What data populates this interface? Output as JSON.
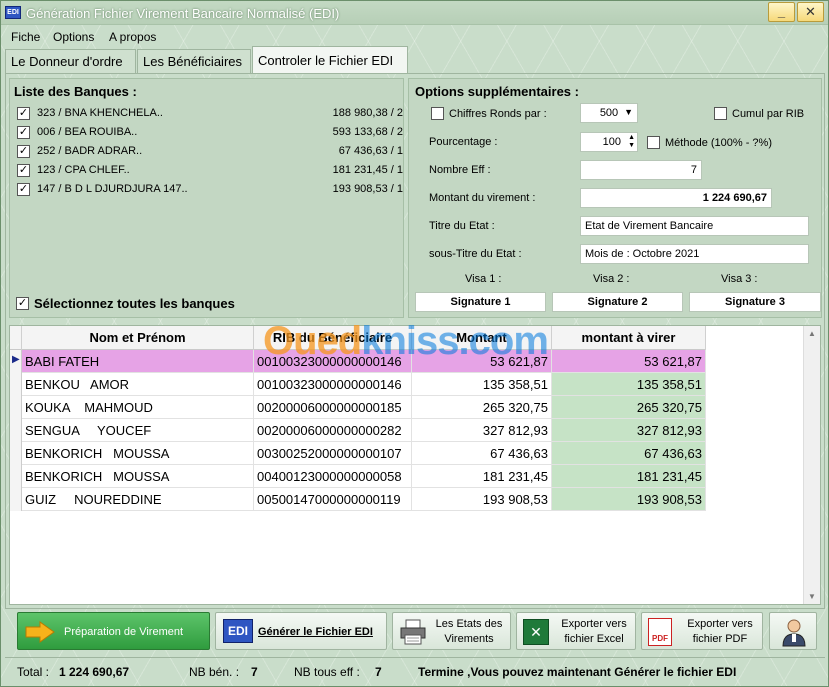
{
  "window": {
    "title": "Génération Fichier Virement Bancaire Normalisé (EDI)",
    "icon_text": "EDI",
    "minimize": "_",
    "close": "✕"
  },
  "menu": [
    "Fiche",
    "Options",
    "A propos"
  ],
  "tabs": [
    "Le Donneur d'ordre",
    "Les Bénéficiaires",
    "Controler le Fichier EDI"
  ],
  "banks": {
    "title": "Liste des Banques :",
    "items": [
      {
        "name": "323 / BNA KHENCHELA..",
        "amount": "188 980,38 / 2",
        "checked": true
      },
      {
        "name": "006 / BEA ROUIBA..",
        "amount": "593 133,68 / 2",
        "checked": true
      },
      {
        "name": "252 / BADR ADRAR..",
        "amount": "67 436,63 / 1",
        "checked": true
      },
      {
        "name": "123 / CPA CHLEF..",
        "amount": "181 231,45 / 1",
        "checked": true
      },
      {
        "name": "147 / B D L  DJURDJURA  147..",
        "amount": "193 908,53 / 1",
        "checked": true
      }
    ],
    "select_all": "Sélectionnez toutes les banques"
  },
  "options": {
    "title": "Options supplémentaires :",
    "chiffres_ronds_label": "Chiffres Ronds par :",
    "chiffres_ronds_value": "500",
    "cumul_rib_label": "Cumul par RIB",
    "pourcentage_label": "Pourcentage :",
    "pourcentage_value": "100",
    "methode_label": "Méthode (100% - ?%)",
    "nombre_eff_label": "Nombre Eff :",
    "nombre_eff_value": "7",
    "montant_label": "Montant du virement :",
    "montant_value": "1 224 690,67",
    "titre_label": "Titre du Etat :",
    "titre_value": "Etat de Virement Bancaire",
    "sous_titre_label": "sous-Titre du Etat :",
    "sous_titre_value": "Mois de : Octobre 2021",
    "visa": [
      {
        "label": "Visa 1 :",
        "signature": "Signature 1"
      },
      {
        "label": "Visa 2 :",
        "signature": "Signature 2"
      },
      {
        "label": "Visa 3 :",
        "signature": "Signature 3"
      }
    ]
  },
  "grid": {
    "columns": [
      "Nom et Prénom",
      "RIB du Bénéficiaire",
      "Montant",
      "montant à virer"
    ],
    "rows": [
      {
        "nom": "BABI FATEH",
        "rib": "00100323000000000146",
        "montant": "53 621,87",
        "virer": "53 621,87"
      },
      {
        "nom": "BENKOU   AMOR",
        "rib": "00100323000000000146",
        "montant": "135 358,51",
        "virer": "135 358,51"
      },
      {
        "nom": "KOUKA    MAHMOUD",
        "rib": "00200006000000000185",
        "montant": "265 320,75",
        "virer": "265 320,75"
      },
      {
        "nom": "SENGUA     YOUCEF",
        "rib": "00200006000000000282",
        "montant": "327 812,93",
        "virer": "327 812,93"
      },
      {
        "nom": "BENKORICH   MOUSSA",
        "rib": "00300252000000000107",
        "montant": "67 436,63",
        "virer": "67 436,63"
      },
      {
        "nom": "BENKORICH   MOUSSA",
        "rib": "00400123000000000058",
        "montant": "181 231,45",
        "virer": "181 231,45"
      },
      {
        "nom": "GUIZ     NOUREDDINE",
        "rib": "00500147000000000119",
        "montant": "193 908,53",
        "virer": "193 908,53"
      }
    ],
    "selected_row_color": "#e6a3e6",
    "virer_color": "#c6e3c6"
  },
  "watermark": {
    "part1": "Oued",
    "part2": "kniss",
    "part3": ".com"
  },
  "actions": {
    "preparation": "Préparation de Virement",
    "generer": "Générer le Fichier EDI",
    "etats_1": "Les Etats des",
    "etats_2": "Virements",
    "excel_1": "Exporter vers",
    "excel_2": "fichier Excel",
    "pdf_1": "Exporter vers",
    "pdf_2": "fichier PDF",
    "edi_icon": "EDI",
    "pdf_icon": "PDF"
  },
  "status": {
    "total_label": "Total :",
    "total_value": "1 224 690,67",
    "nb_ben_label": "NB bén. :",
    "nb_ben_value": "7",
    "nb_eff_label": "NB tous eff :",
    "nb_eff_value": "7",
    "message": "Termine ,Vous pouvez maintenant Générer le fichier EDI"
  }
}
